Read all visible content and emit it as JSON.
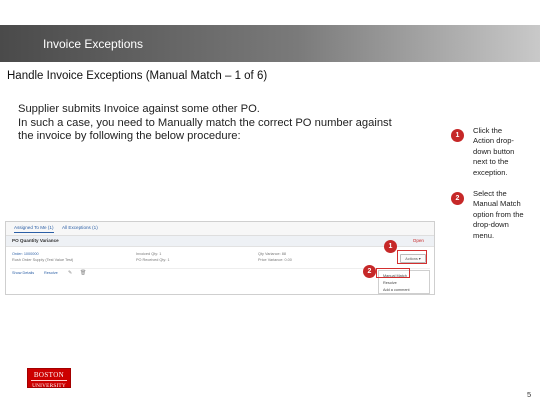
{
  "header": {
    "title": "Invoice Exceptions"
  },
  "subtitle": "Handle Invoice Exceptions (Manual Match – 1 of 6)",
  "body_lines": [
    "Supplier submits Invoice against some other PO.",
    "In such a case, you need to Manually match the correct PO number against",
    "the invoice by following the  below procedure:"
  ],
  "steps": [
    {
      "number": "1",
      "lines": [
        "Click the",
        "Action drop-",
        "down button",
        "next to the",
        "exception."
      ]
    },
    {
      "number": "2",
      "lines": [
        "Select the",
        "Manual Match",
        "option from the",
        "drop-down",
        "menu."
      ]
    }
  ],
  "mock_screenshot": {
    "tabs": [
      "Assigned To Me (1)",
      "All Exceptions (1)"
    ],
    "section_label": "PO Quantity Variance",
    "status": "Open",
    "row": {
      "order_label": "Order: 1000000",
      "order_detail": "Rush Order Supply (Test Value Test)",
      "col2_line1": "Invoiced Qty: 1",
      "col2_line2": "PO Received Qty: 1",
      "col3_line1": "Qty Variance: 88",
      "col3_line2": "Price Variance: 0.00",
      "link1": "Show Details",
      "link2": "Resolve",
      "actions_label": "Actions ▾"
    },
    "menu_items": [
      "Manual Match",
      "Resolve",
      "Add a comment"
    ],
    "callouts": [
      "1",
      "2"
    ]
  },
  "logo": {
    "line1": "BOSTON",
    "line2": "UNIVERSITY"
  },
  "page_number": "5",
  "colors": {
    "accent": "#c62828",
    "header_dark": "#4a4a4a",
    "header_light": "#c9c9c9"
  }
}
